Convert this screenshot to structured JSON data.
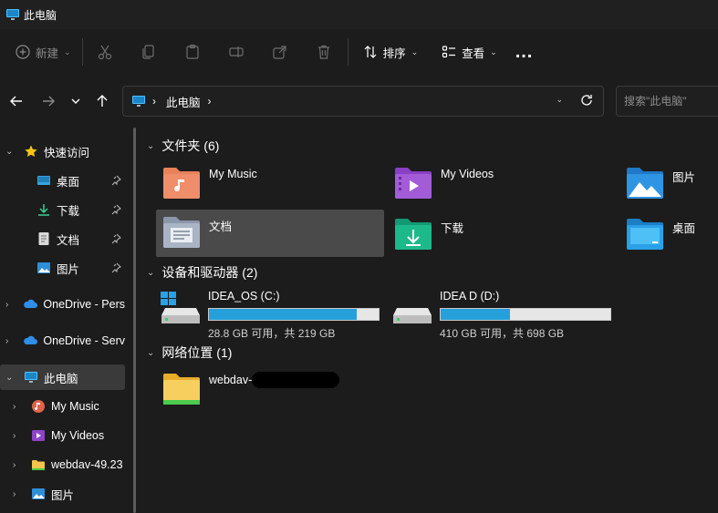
{
  "window": {
    "title": "此电脑"
  },
  "toolbar": {
    "new_label": "新建",
    "sort_label": "排序",
    "view_label": "查看",
    "more_label": "..."
  },
  "address": {
    "crumb": "此电脑"
  },
  "search": {
    "placeholder": "搜索\"此电脑\""
  },
  "sidebar": {
    "items": [
      {
        "label": "快速访问"
      },
      {
        "label": "桌面"
      },
      {
        "label": "下载"
      },
      {
        "label": "文档"
      },
      {
        "label": "图片"
      },
      {
        "label": "OneDrive - Pers"
      },
      {
        "label": "OneDrive - Serv"
      },
      {
        "label": "此电脑"
      },
      {
        "label": "My Music"
      },
      {
        "label": "My Videos"
      },
      {
        "label": "webdav-49.23"
      },
      {
        "label": "图片"
      }
    ]
  },
  "groups": {
    "folders": "文件夹 (6)",
    "devices": "设备和驱动器 (2)",
    "network": "网络位置 (1)"
  },
  "folders": [
    {
      "label": "My Music"
    },
    {
      "label": "My Videos"
    },
    {
      "label": "图片"
    },
    {
      "label": "文档"
    },
    {
      "label": "下载"
    },
    {
      "label": "桌面"
    }
  ],
  "drives": [
    {
      "name": "IDEA_OS (C:)",
      "size": "28.8 GB 可用，共 219 GB",
      "used_fraction": 0.87
    },
    {
      "name": "IDEA D (D:)",
      "size": "410 GB 可用，共 698 GB",
      "used_fraction": 0.41
    }
  ],
  "network": {
    "label": "webdav-"
  },
  "colors": {
    "accent": "#26a0da",
    "background": "#1c1c1c",
    "selected": "#4a4a4a"
  }
}
